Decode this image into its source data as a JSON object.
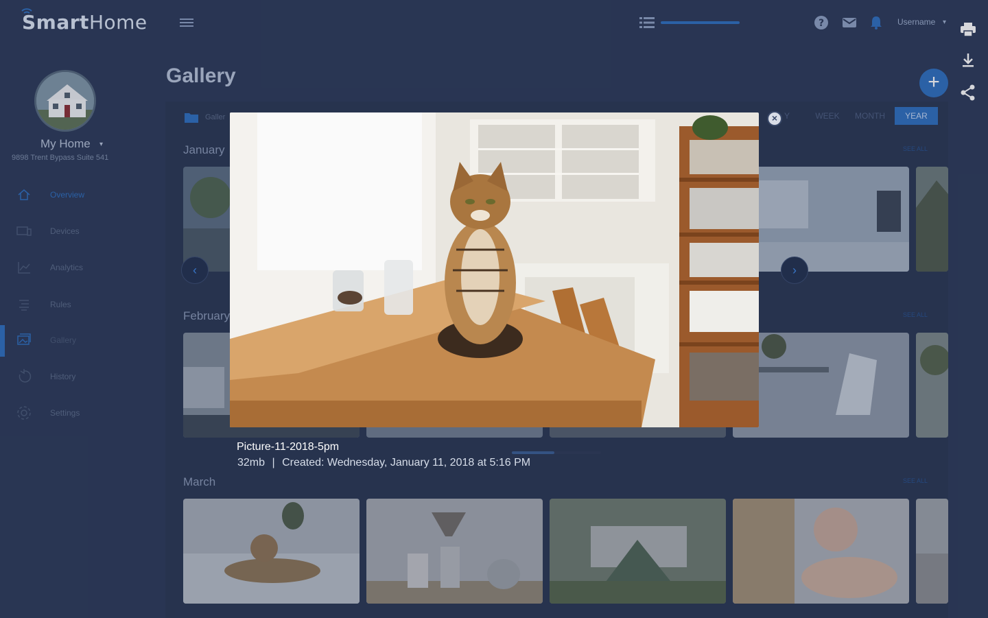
{
  "app": {
    "brand_bold": "Smart",
    "brand_light": "Home",
    "username": "Username"
  },
  "home": {
    "name": "My Home",
    "address": "9898 Trent Bypass Suite 541"
  },
  "nav": [
    {
      "label": "Overview",
      "icon": "home-icon"
    },
    {
      "label": "Devices",
      "icon": "devices-icon"
    },
    {
      "label": "Analytics",
      "icon": "analytics-icon"
    },
    {
      "label": "Rules",
      "icon": "rules-icon"
    },
    {
      "label": "Gallery",
      "icon": "gallery-icon",
      "active": true
    },
    {
      "label": "History",
      "icon": "history-icon"
    },
    {
      "label": "Settings",
      "icon": "settings-icon"
    }
  ],
  "page": {
    "title": "Gallery",
    "breadcrumb": "Galler",
    "range_tabs": [
      "Y",
      "WEEK",
      "MONTH",
      "YEAR"
    ],
    "active_range": "YEAR",
    "see_all": "SEE ALL"
  },
  "sections": [
    {
      "month": "January"
    },
    {
      "month": "February"
    },
    {
      "month": "March"
    }
  ],
  "lightbox": {
    "title": "Picture-11-2018-5pm",
    "size": "32mb",
    "separator": "|",
    "created": "Created: Wednesday, January 11, 2018 at 5:16 PM"
  },
  "actions": [
    "print-icon",
    "download-icon",
    "share-icon"
  ],
  "colors": {
    "accent": "#2f6fbf",
    "background": "#2c3a59"
  }
}
